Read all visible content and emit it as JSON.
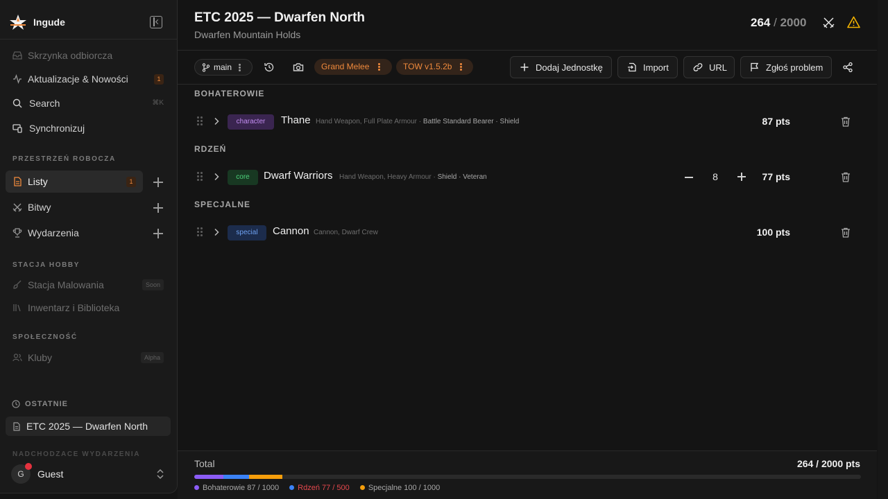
{
  "app": {
    "name": "Ingude"
  },
  "sidebar": {
    "items_top": [
      {
        "label": "Skrzynka odbiorcza",
        "icon": "inbox-icon",
        "dim": true
      },
      {
        "label": "Aktualizacje & Nowości",
        "icon": "activity-icon",
        "badge": "1"
      },
      {
        "label": "Search",
        "icon": "search-icon",
        "shortcut": "⌘K"
      },
      {
        "label": "Synchronizuj",
        "icon": "sync-devices-icon"
      }
    ],
    "workspace_title": "PRZESTRZEŃ ROBOCZA",
    "workspace": [
      {
        "label": "Listy",
        "icon": "file-list-icon",
        "badge": "1"
      },
      {
        "label": "Bitwy",
        "icon": "crossed-swords-icon"
      },
      {
        "label": "Wydarzenia",
        "icon": "trophy-icon"
      }
    ],
    "hobby_title": "STACJA HOBBY",
    "hobby": [
      {
        "label": "Stacja Malowania",
        "icon": "paintbrush-icon",
        "pill": "Soon"
      },
      {
        "label": "Inwentarz i Biblioteka",
        "icon": "library-icon"
      }
    ],
    "community_title": "SPOŁECZNOŚĆ",
    "community": [
      {
        "label": "Kluby",
        "icon": "users-icon",
        "pill": "Alpha"
      }
    ],
    "recent_title": "OSTATNIE",
    "recent": [
      {
        "label": "ETC 2025 — Dwarfen North"
      }
    ],
    "upcoming_title": "NADCHODZĄCE WYDARZENIA",
    "user": {
      "initial": "G",
      "name": "Guest"
    }
  },
  "header": {
    "title": "ETC 2025 — Dwarfen North",
    "subtitle": "Dwarfen Mountain Holds",
    "points_current": "264",
    "points_sep": "/",
    "points_max": "2000"
  },
  "toolbar": {
    "branch": "main",
    "format": "Grand Melee",
    "version": "TOW v1.5.2b",
    "add_unit": "Dodaj Jednostkę",
    "import": "Import",
    "url": "URL",
    "report": "Zgłoś problem"
  },
  "categories": [
    {
      "title": "BOHATEROWIE"
    },
    {
      "title": "RDZEŃ"
    },
    {
      "title": "SPECJALNE"
    }
  ],
  "units": [
    {
      "tag": "character",
      "name": "Thane",
      "equipment": "Hand Weapon, Full Plate Armour",
      "options": "Battle Standard Bearer · Shield",
      "points": "87 pts"
    },
    {
      "tag": "core",
      "name": "Dwarf Warriors",
      "equipment": "Hand Weapon, Heavy Armour",
      "options": "Shield · Veteran",
      "quantity": "8",
      "points": "77 pts"
    },
    {
      "tag": "special",
      "name": "Cannon",
      "equipment": "Cannon, Dwarf Crew",
      "points": "100 pts"
    }
  ],
  "footer": {
    "total_label": "Total",
    "total_value": "264 / 2000 pts",
    "bar": {
      "max": 2000,
      "segments": [
        {
          "name": "Bohaterowie",
          "value": 87,
          "color": "#8b5cf6"
        },
        {
          "name": "Rdzeń",
          "value": 77,
          "color": "#3b82f6"
        },
        {
          "name": "Specjalne",
          "value": 100,
          "color": "#f59e0b"
        }
      ]
    },
    "legend": [
      {
        "label": "Bohaterowie 87 / 1000",
        "color": "#8b5cf6"
      },
      {
        "label": "Rdzeń 77 / 500",
        "color": "#3b82f6",
        "over": true
      },
      {
        "label": "Specjalne 100 / 1000",
        "color": "#f59e0b"
      }
    ]
  }
}
